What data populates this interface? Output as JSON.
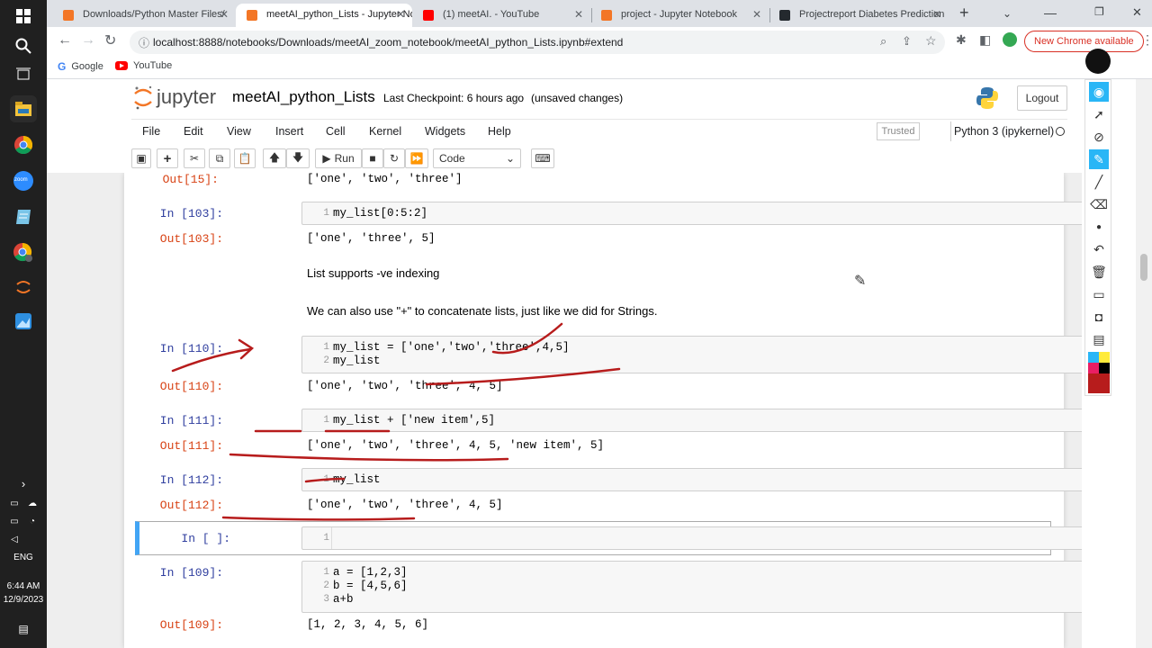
{
  "taskbar": {
    "time": "6:44 AM",
    "date": "12/9/2023",
    "lang": "ENG",
    "zoom_label": "zoom"
  },
  "tabs": [
    {
      "title": "Downloads/Python Master Files/",
      "active": false,
      "color": "#f37626"
    },
    {
      "title": "meetAI_python_Lists - Jupyter No",
      "active": true,
      "color": "#f37626"
    },
    {
      "title": "(1) meetAI. - YouTube",
      "active": false,
      "color": "#ff0000"
    },
    {
      "title": "project - Jupyter Notebook",
      "active": false,
      "color": "#f37626"
    },
    {
      "title": "Projectreport Diabetes Prediction",
      "active": false,
      "color": "#24292e"
    }
  ],
  "address": {
    "url": "localhost:8888/notebooks/Downloads/meetAI_zoom_notebook/meetAI_python_Lists.ipynb#extend",
    "chrome_badge": "New Chrome available"
  },
  "bookmarks": [
    "Google",
    "YouTube"
  ],
  "jupyter": {
    "logo": "jupyter",
    "notebook_name": "meetAI_python_Lists",
    "checkpoint": "Last Checkpoint: 6 hours ago",
    "unsaved": "(unsaved changes)",
    "logout": "Logout",
    "trusted": "Trusted",
    "kernel": "Python 3 (ipykernel)"
  },
  "menu": [
    "File",
    "Edit",
    "View",
    "Insert",
    "Cell",
    "Kernel",
    "Widgets",
    "Help"
  ],
  "toolbar": {
    "run": "Run",
    "cell_type": "Code"
  },
  "cells": {
    "out15_prompt": "Out[15]:",
    "out15": "['one', 'two', 'three']",
    "in103_prompt": "In [103]:",
    "in103": "my_list[0:5:2]",
    "out103_prompt": "Out[103]:",
    "out103": "['one', 'three', 5]",
    "md1": "List supports -ve indexing",
    "md2": "We can also use \"+\" to concatenate lists, just like we did for Strings.",
    "in110_prompt": "In [110]:",
    "in110_l1": "my_list = ['one','two','three',4,5]",
    "in110_l2": "my_list",
    "out110_prompt": "Out[110]:",
    "out110": "['one', 'two', 'three', 4, 5]",
    "in111_prompt": "In [111]:",
    "in111": "my_list + ['new item',5]",
    "out111_prompt": "Out[111]:",
    "out111": "['one', 'two', 'three', 4, 5, 'new item', 5]",
    "in112_prompt": "In [112]:",
    "in112": "my_list",
    "out112_prompt": "Out[112]:",
    "out112": "['one', 'two', 'three', 4, 5]",
    "inempty_prompt": "In [ ]:",
    "in109_prompt": "In [109]:",
    "in109_l1": "a = [1,2,3]",
    "in109_l2": "b = [4,5,6]",
    "in109_l3": "a+b",
    "out109_prompt": "Out[109]:",
    "out109": "[1, 2, 3, 4, 5, 6]"
  },
  "line_numbers": [
    "1",
    "2",
    "3"
  ],
  "colors": {
    "annotation": "#b71c1c",
    "active_cell": "#42a5f5"
  }
}
